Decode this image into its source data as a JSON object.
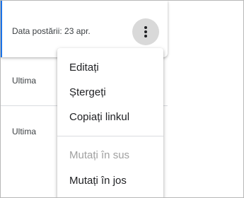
{
  "card": {
    "posted_label": "Data postării: 23 apr.",
    "more_icon": "more-vert-icon"
  },
  "rows": [
    {
      "label": "Ultima"
    },
    {
      "label": "Ultima"
    }
  ],
  "menu": {
    "items": [
      {
        "label": "Editați",
        "enabled": true
      },
      {
        "label": "Ștergeți",
        "enabled": true
      },
      {
        "label": "Copiați linkul",
        "enabled": true
      },
      {
        "label": "Mutați în sus",
        "enabled": false
      },
      {
        "label": "Mutați în jos",
        "enabled": true
      }
    ]
  },
  "colors": {
    "accent": "#1a73e8",
    "disabled_text": "#a0a0a0"
  }
}
